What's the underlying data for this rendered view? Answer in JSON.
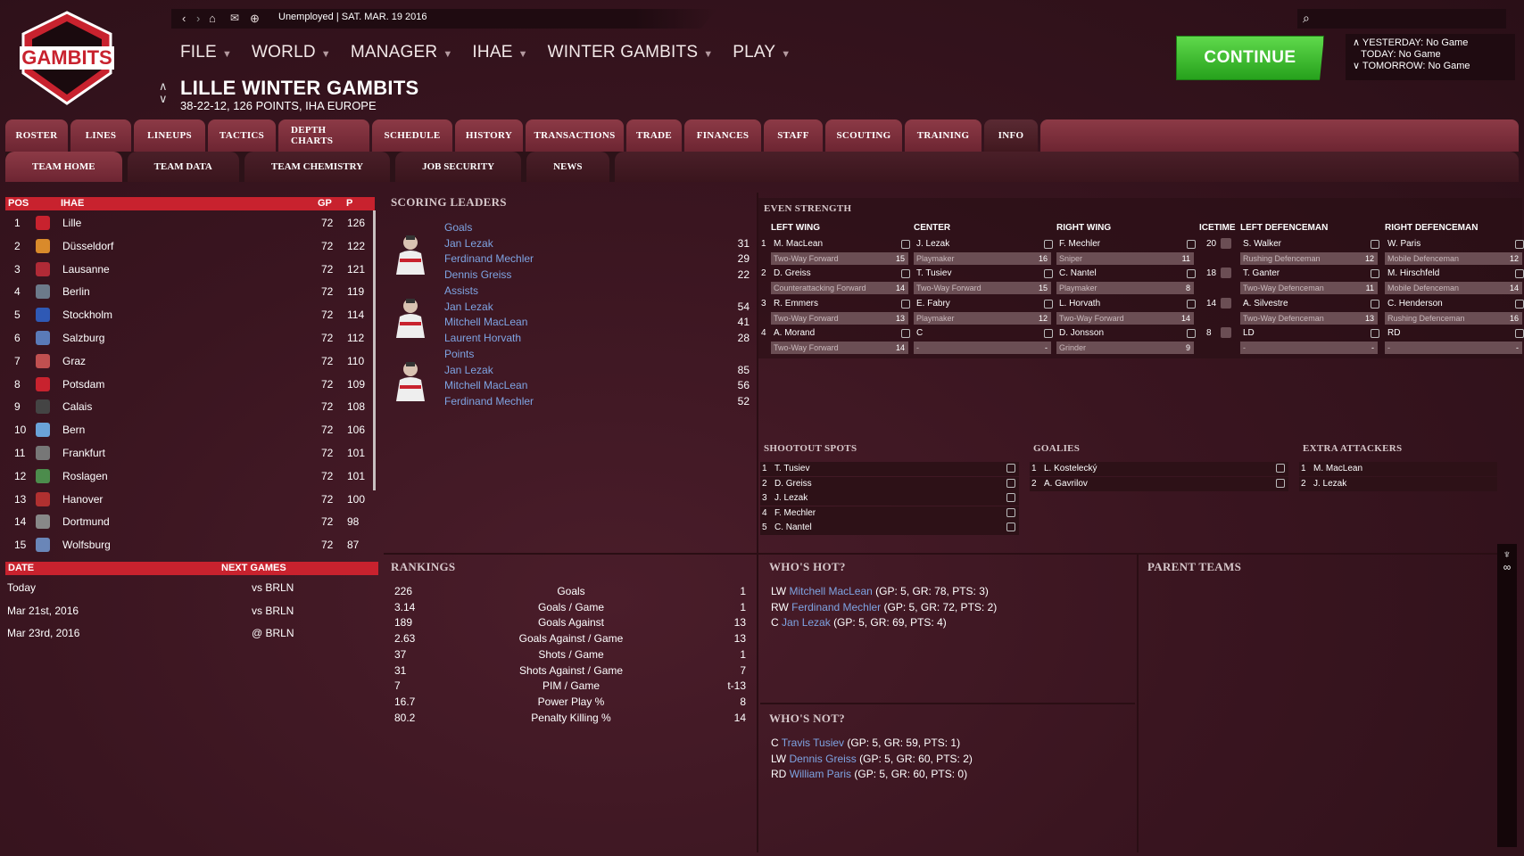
{
  "topbar": {
    "status": "Unemployed | SAT. MAR. 19 2016"
  },
  "logo_text": "GAMBITS",
  "menu": [
    "FILE",
    "WORLD",
    "MANAGER",
    "IHAE",
    "WINTER GAMBITS",
    "PLAY"
  ],
  "team": {
    "name": "LILLE WINTER GAMBITS",
    "summary": "38-22-12, 126 POINTS, IHA EUROPE"
  },
  "continue_label": "CONTINUE",
  "days": [
    "YESTERDAY: No Game",
    "TODAY: No Game",
    "TOMORROW: No Game"
  ],
  "tabs": [
    "ROSTER",
    "LINES",
    "LINEUPS",
    "TACTICS",
    "DEPTH CHARTS",
    "SCHEDULE",
    "HISTORY",
    "TRANSACTIONS",
    "TRADE",
    "FINANCES",
    "STAFF",
    "SCOUTING",
    "TRAINING",
    "INFO"
  ],
  "subtabs": [
    "TEAM HOME",
    "TEAM DATA",
    "TEAM CHEMISTRY",
    "JOB SECURITY",
    "NEWS"
  ],
  "standings": {
    "headers": [
      "POS",
      "IHAE",
      "GP",
      "P"
    ],
    "rows": [
      [
        "1",
        "Lille",
        "72",
        "126"
      ],
      [
        "2",
        "Düsseldorf",
        "72",
        "122"
      ],
      [
        "3",
        "Lausanne",
        "72",
        "121"
      ],
      [
        "4",
        "Berlin",
        "72",
        "119"
      ],
      [
        "5",
        "Stockholm",
        "72",
        "114"
      ],
      [
        "6",
        "Salzburg",
        "72",
        "112"
      ],
      [
        "7",
        "Graz",
        "72",
        "110"
      ],
      [
        "8",
        "Potsdam",
        "72",
        "109"
      ],
      [
        "9",
        "Calais",
        "72",
        "108"
      ],
      [
        "10",
        "Bern",
        "72",
        "106"
      ],
      [
        "11",
        "Frankfurt",
        "72",
        "101"
      ],
      [
        "12",
        "Roslagen",
        "72",
        "101"
      ],
      [
        "13",
        "Hanover",
        "72",
        "100"
      ],
      [
        "14",
        "Dortmund",
        "72",
        "98"
      ],
      [
        "15",
        "Wolfsburg",
        "72",
        "87"
      ]
    ]
  },
  "games": {
    "headers": [
      "DATE",
      "NEXT GAMES"
    ],
    "rows": [
      [
        "Today",
        "vs BRLN"
      ],
      [
        "Mar 21st, 2016",
        "vs BRLN"
      ],
      [
        "Mar 23rd, 2016",
        "@ BRLN"
      ]
    ]
  },
  "scoring": {
    "title": "SCORING LEADERS",
    "groups": [
      {
        "cat": "Goals",
        "rows": [
          [
            "Jan Lezak",
            "31"
          ],
          [
            "Ferdinand Mechler",
            "29"
          ],
          [
            "Dennis Greiss",
            "22"
          ]
        ]
      },
      {
        "cat": "Assists",
        "rows": [
          [
            "Jan Lezak",
            "54"
          ],
          [
            "Mitchell MacLean",
            "41"
          ],
          [
            "Laurent Horvath",
            "28"
          ]
        ]
      },
      {
        "cat": "Points",
        "rows": [
          [
            "Jan Lezak",
            "85"
          ],
          [
            "Mitchell MacLean",
            "56"
          ],
          [
            "Ferdinand Mechler",
            "52"
          ]
        ]
      }
    ]
  },
  "lines": {
    "title": "EVEN STRENGTH",
    "headers": [
      "LEFT WING",
      "CENTER",
      "RIGHT WING",
      "ICETIME",
      "LEFT DEFENCEMAN",
      "RIGHT DEFENCEMAN"
    ],
    "rows": [
      {
        "n": "1",
        "lw": [
          "M. MacLean",
          "Two-Way Forward",
          "15"
        ],
        "c": [
          "J. Lezak",
          "Playmaker",
          "16"
        ],
        "rw": [
          "F. Mechler",
          "Sniper",
          "11"
        ],
        "ice": "20",
        "ld": [
          "S. Walker",
          "Rushing Defenceman",
          "12"
        ],
        "rd": [
          "W. Paris",
          "Mobile Defenceman",
          "12"
        ]
      },
      {
        "n": "2",
        "lw": [
          "D. Greiss",
          "Counterattacking Forward",
          "14"
        ],
        "c": [
          "T. Tusiev",
          "Two-Way Forward",
          "15"
        ],
        "rw": [
          "C. Nantel",
          "Playmaker",
          "8"
        ],
        "ice": "18",
        "ld": [
          "T. Ganter",
          "Two-Way Defenceman",
          "11"
        ],
        "rd": [
          "M. Hirschfeld",
          "Mobile Defenceman",
          "14"
        ]
      },
      {
        "n": "3",
        "lw": [
          "R. Emmers",
          "Two-Way Forward",
          "13"
        ],
        "c": [
          "E. Fabry",
          "Playmaker",
          "12"
        ],
        "rw": [
          "L. Horvath",
          "Two-Way Forward",
          "14"
        ],
        "ice": "14",
        "ld": [
          "A. Silvestre",
          "Two-Way Defenceman",
          "13"
        ],
        "rd": [
          "C. Henderson",
          "Rushing Defenceman",
          "16"
        ]
      },
      {
        "n": "4",
        "lw": [
          "A. Morand",
          "Two-Way Forward",
          "14"
        ],
        "c": [
          "C",
          "-",
          "-"
        ],
        "rw": [
          "D. Jonsson",
          "Grinder",
          "9"
        ],
        "ice": "8",
        "ld": [
          "LD",
          "-",
          "-"
        ],
        "rd": [
          "RD",
          "-",
          "-"
        ]
      }
    ]
  },
  "shootout": {
    "title": "SHOOTOUT SPOTS",
    "rows": [
      [
        "1",
        "T. Tusiev"
      ],
      [
        "2",
        "D. Greiss"
      ],
      [
        "3",
        "J. Lezak"
      ],
      [
        "4",
        "F. Mechler"
      ],
      [
        "5",
        "C. Nantel"
      ]
    ]
  },
  "goalies": {
    "title": "GOALIES",
    "rows": [
      [
        "1",
        "L. Kostelecký"
      ],
      [
        "2",
        "A. Gavrilov"
      ]
    ]
  },
  "extra": {
    "title": "EXTRA ATTACKERS",
    "rows": [
      [
        "1",
        "M. MacLean"
      ],
      [
        "2",
        "J. Lezak"
      ]
    ]
  },
  "rankings": {
    "title": "RANKINGS",
    "rows": [
      [
        "226",
        "Goals",
        "1"
      ],
      [
        "3.14",
        "Goals / Game",
        "1"
      ],
      [
        "189",
        "Goals Against",
        "13"
      ],
      [
        "2.63",
        "Goals Against / Game",
        "13"
      ],
      [
        "37",
        "Shots / Game",
        "1"
      ],
      [
        "31",
        "Shots Against / Game",
        "7"
      ],
      [
        "7",
        "PIM / Game",
        "t-13"
      ],
      [
        "16.7",
        "Power Play %",
        "8"
      ],
      [
        "80.2",
        "Penalty Killing %",
        "14"
      ]
    ]
  },
  "hot": {
    "title": "WHO'S HOT?",
    "rows": [
      [
        "LW",
        "Mitchell MacLean",
        "(GP: 5, GR: 78, PTS: 3)"
      ],
      [
        "RW",
        "Ferdinand Mechler",
        "(GP: 5, GR: 72, PTS: 2)"
      ],
      [
        "C",
        "Jan Lezak",
        "(GP: 5, GR: 69, PTS: 4)"
      ]
    ]
  },
  "not": {
    "title": "WHO'S NOT?",
    "rows": [
      [
        "C",
        "Travis Tusiev",
        "(GP: 5, GR: 59, PTS: 1)"
      ],
      [
        "LW",
        "Dennis Greiss",
        "(GP: 5, GR: 60, PTS: 2)"
      ],
      [
        "RD",
        "William Paris",
        "(GP: 5, GR: 60, PTS: 0)"
      ]
    ]
  },
  "parent_title": "PARENT TEAMS",
  "colors": {
    "accent_red": "#c8222e",
    "continue_green": "#3cbf2c",
    "link_blue": "#7ea4e3"
  }
}
